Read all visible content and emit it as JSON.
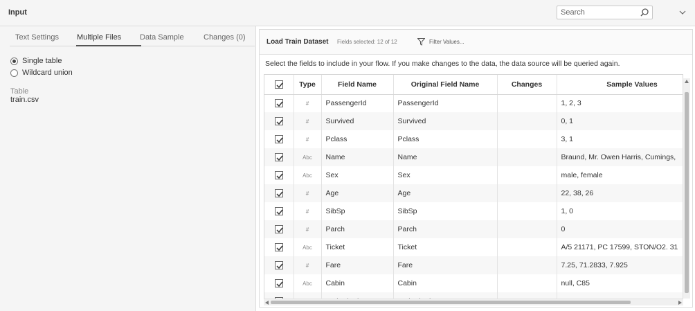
{
  "header": {
    "title": "Input",
    "search_placeholder": "Search"
  },
  "left": {
    "tabs": [
      {
        "label": "Text Settings",
        "active": false
      },
      {
        "label": "Multiple Files",
        "active": true
      },
      {
        "label": "Data Sample",
        "active": false
      },
      {
        "label": "Changes (0)",
        "active": false
      }
    ],
    "options": [
      {
        "label": "Single table",
        "checked": true
      },
      {
        "label": "Wildcard union",
        "checked": false
      }
    ],
    "table_label": "Table",
    "table_value": "train.csv"
  },
  "right": {
    "title": "Load Train Dataset",
    "fields_selected": "Fields selected: 12 of 12",
    "filter_label": "Filter Values...",
    "instructions": "Select the fields to include in your flow. If you make changes to the data, the data source will be queried again.",
    "columns": [
      "Type",
      "Field Name",
      "Original Field Name",
      "Changes",
      "Sample Values"
    ],
    "rows": [
      {
        "checked": true,
        "type": "#",
        "field": "PassengerId",
        "original": "PassengerId",
        "changes": "",
        "sample": "1, 2, 3"
      },
      {
        "checked": true,
        "type": "#",
        "field": "Survived",
        "original": "Survived",
        "changes": "",
        "sample": "0, 1"
      },
      {
        "checked": true,
        "type": "#",
        "field": "Pclass",
        "original": "Pclass",
        "changes": "",
        "sample": "3, 1"
      },
      {
        "checked": true,
        "type": "Abc",
        "field": "Name",
        "original": "Name",
        "changes": "",
        "sample": "Braund, Mr. Owen Harris, Cumings,"
      },
      {
        "checked": true,
        "type": "Abc",
        "field": "Sex",
        "original": "Sex",
        "changes": "",
        "sample": "male, female"
      },
      {
        "checked": true,
        "type": "#",
        "field": "Age",
        "original": "Age",
        "changes": "",
        "sample": "22, 38, 26"
      },
      {
        "checked": true,
        "type": "#",
        "field": "SibSp",
        "original": "SibSp",
        "changes": "",
        "sample": "1, 0"
      },
      {
        "checked": true,
        "type": "#",
        "field": "Parch",
        "original": "Parch",
        "changes": "",
        "sample": "0"
      },
      {
        "checked": true,
        "type": "Abc",
        "field": "Ticket",
        "original": "Ticket",
        "changes": "",
        "sample": "A/5 21171, PC 17599, STON/O2. 31"
      },
      {
        "checked": true,
        "type": "#",
        "field": "Fare",
        "original": "Fare",
        "changes": "",
        "sample": "7.25, 71.2833, 7.925"
      },
      {
        "checked": true,
        "type": "Abc",
        "field": "Cabin",
        "original": "Cabin",
        "changes": "",
        "sample": "null, C85"
      },
      {
        "checked": true,
        "type": "Abc",
        "field": "Embarked",
        "original": "Embarked",
        "changes": "",
        "sample": "S, C"
      }
    ]
  }
}
